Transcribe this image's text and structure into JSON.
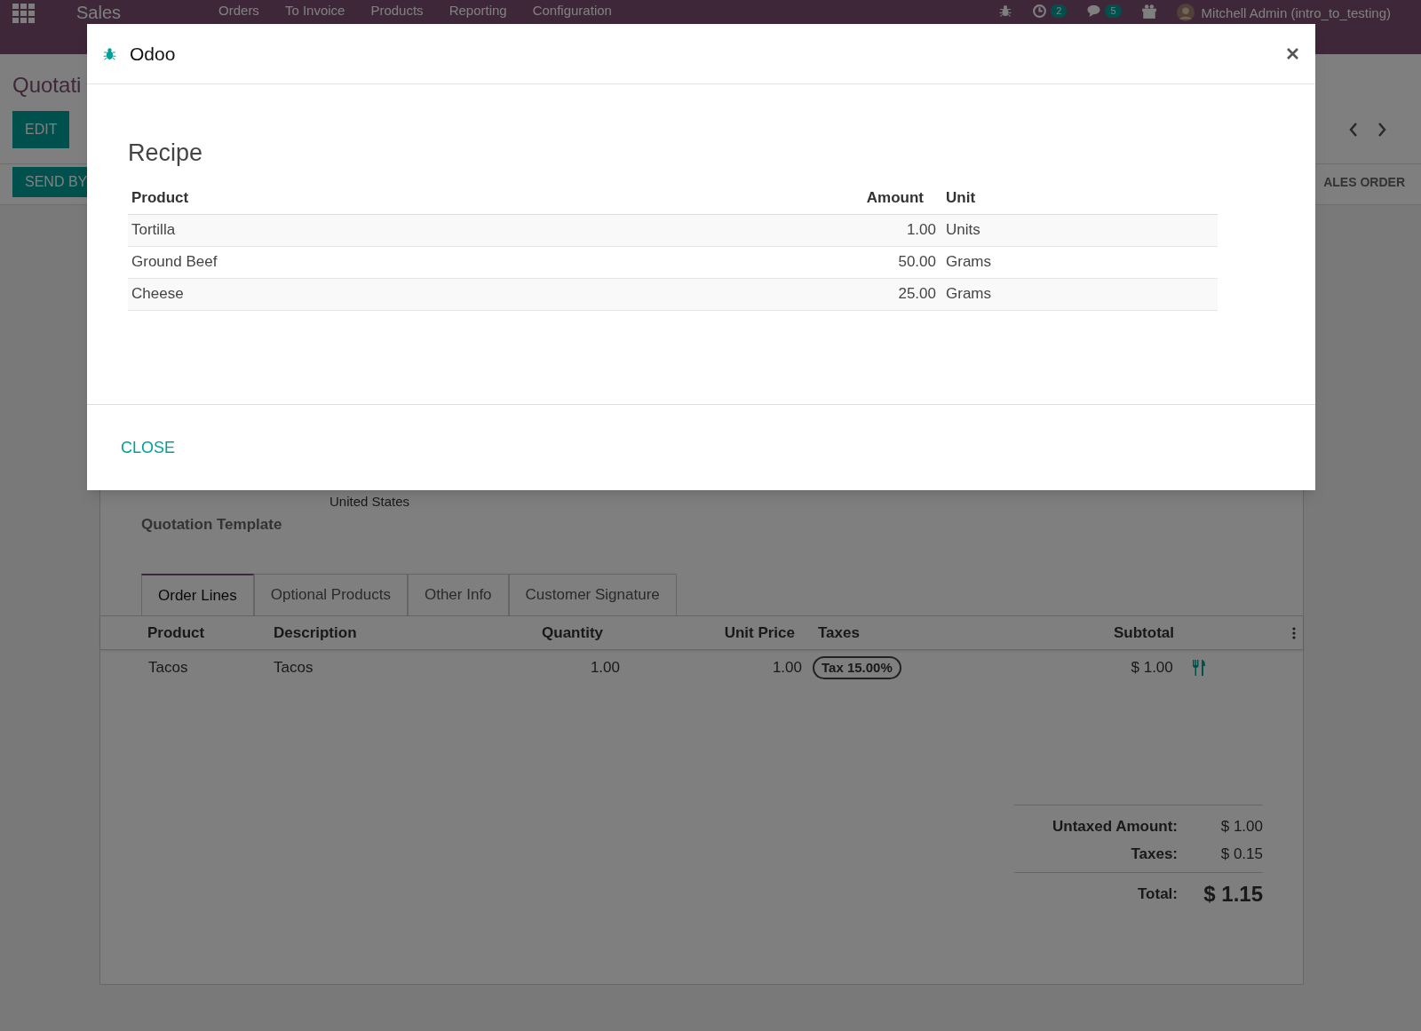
{
  "navbar": {
    "app_name": "Sales",
    "menu": [
      "Orders",
      "To Invoice",
      "Products",
      "Reporting",
      "Configuration"
    ],
    "activity_count": "2",
    "message_count": "5",
    "user": "Mitchell Admin (intro_to_testing)"
  },
  "control_panel": {
    "breadcrumb": "Quotati",
    "edit": "EDIT",
    "send": "SEND BY",
    "status": "ALES ORDER"
  },
  "form": {
    "address_line": "United States",
    "template_label": "Quotation Template",
    "tabs": [
      {
        "label": "Order Lines",
        "selected": true
      },
      {
        "label": "Optional Products",
        "selected": false
      },
      {
        "label": "Other Info",
        "selected": false
      },
      {
        "label": "Customer Signature",
        "selected": false
      }
    ],
    "columns": [
      "Product",
      "Description",
      "Quantity",
      "Unit Price",
      "Taxes",
      "Subtotal"
    ],
    "rows": [
      {
        "product": "Tacos",
        "description": "Tacos",
        "quantity": "1.00",
        "unit_price": "1.00",
        "tax": "Tax 15.00%",
        "subtotal": "$ 1.00"
      }
    ],
    "totals": [
      {
        "label": "Untaxed Amount:",
        "value": "$ 1.00",
        "kind": "line"
      },
      {
        "label": "Taxes:",
        "value": "$ 0.15",
        "kind": "line"
      },
      {
        "label": "Total:",
        "value": "$ 1.15",
        "kind": "total"
      }
    ]
  },
  "dialog": {
    "title": "Odoo",
    "heading": "Recipe",
    "columns": [
      "Product",
      "Amount",
      "Unit"
    ],
    "rows": [
      {
        "product": "Tortilla",
        "amount": "1.00",
        "unit": "Units"
      },
      {
        "product": "Ground Beef",
        "amount": "50.00",
        "unit": "Grams"
      },
      {
        "product": "Cheese",
        "amount": "25.00",
        "unit": "Grams"
      }
    ],
    "close": "CLOSE"
  }
}
